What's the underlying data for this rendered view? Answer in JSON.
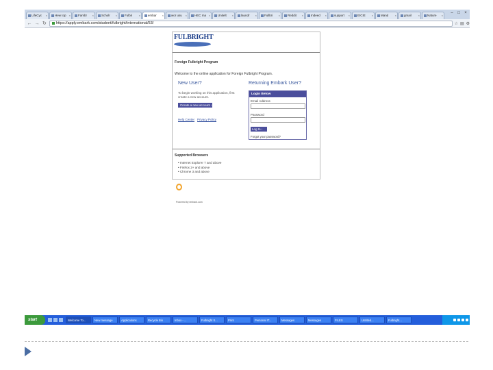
{
  "browser": {
    "tabs": [
      {
        "label": "LifeCyc"
      },
      {
        "label": "Hew top"
      },
      {
        "label": "Fambr"
      },
      {
        "label": "Scholr"
      },
      {
        "label": "Fulbri"
      },
      {
        "label": "embar",
        "active": true
      },
      {
        "label": "wor usu"
      },
      {
        "label": "HEC ma"
      },
      {
        "label": "Unitelt"
      },
      {
        "label": "laundr"
      },
      {
        "label": "Fullbri"
      },
      {
        "label": "Reddit"
      },
      {
        "label": "Indeed"
      },
      {
        "label": "support"
      },
      {
        "label": "EICIE"
      },
      {
        "label": "Mand"
      },
      {
        "label": "gmail"
      },
      {
        "label": "Nature"
      }
    ],
    "url": "https://apply.embark.com/student/fulbright/international/53/",
    "window_controls": [
      "–",
      "□",
      "×"
    ]
  },
  "page": {
    "logo_text": "FULBRIGHT",
    "program_title": "Foreign Fulbright Program",
    "welcome_text": "Welcome to the online application for Foreign Fulbright Program.",
    "new_user": {
      "heading": "New User?",
      "lines": [
        "To begin working on this application, first",
        "create a new account."
      ],
      "create_button": "Create a new account ›",
      "help_center": "Help Center",
      "privacy_policy": "Privacy Policy"
    },
    "returning": {
      "heading": "Returning Embark User?",
      "login_header": "Login Below",
      "email_label": "Email Address",
      "password_label": "Password",
      "login_button": "Log In ›",
      "reset_link": "Forgot your password?"
    },
    "supported_title": "Supported Browsers",
    "browsers": [
      "Internet Explorer 7 and above",
      "Firefox 2+ and above",
      "Chrome 3 and above"
    ],
    "footer_tiny": "Powered by embark.com"
  },
  "taskbar": {
    "start_label": "start",
    "tasks": [
      {
        "label": "Welcome To...",
        "active": true
      },
      {
        "label": "New message"
      },
      {
        "label": "Applications"
      },
      {
        "label": "Recycle Bin"
      },
      {
        "label": "Inbox - ..."
      },
      {
        "label": "Fulbright S..."
      },
      {
        "label": "Print"
      },
      {
        "label": "Personal IT..."
      },
      {
        "label": "Messages"
      },
      {
        "label": "Messages"
      },
      {
        "label": "FILES"
      },
      {
        "label": "Untitled..."
      },
      {
        "label": "Fulbright..."
      }
    ]
  }
}
